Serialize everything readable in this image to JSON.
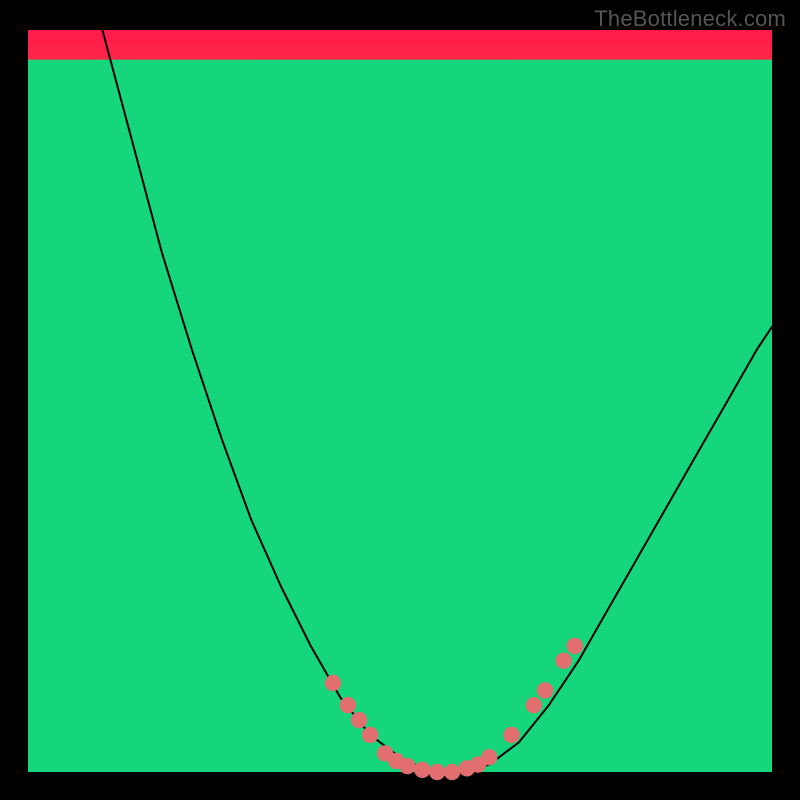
{
  "watermark": "TheBottleneck.com",
  "chart_data": {
    "type": "line",
    "title": "",
    "xlabel": "",
    "ylabel": "",
    "xlim": [
      0,
      100
    ],
    "ylim": [
      0,
      100
    ],
    "background_gradient": {
      "stops": [
        {
          "offset": 0,
          "color": "#ff1a4b"
        },
        {
          "offset": 25,
          "color": "#ff6a3a"
        },
        {
          "offset": 50,
          "color": "#ffd23a"
        },
        {
          "offset": 72,
          "color": "#fff85a"
        },
        {
          "offset": 85,
          "color": "#e8ffb8"
        },
        {
          "offset": 93,
          "color": "#8dffc0"
        },
        {
          "offset": 100,
          "color": "#1be08a"
        }
      ]
    },
    "bottom_band": {
      "from_y": 96,
      "to_y": 100,
      "color": "#15d67a"
    },
    "series": [
      {
        "name": "bottleneck-curve",
        "color": "#000000",
        "width": 2,
        "points": [
          {
            "x": 10,
            "y": 100
          },
          {
            "x": 14,
            "y": 85
          },
          {
            "x": 18,
            "y": 70
          },
          {
            "x": 22,
            "y": 57
          },
          {
            "x": 26,
            "y": 45
          },
          {
            "x": 30,
            "y": 34
          },
          {
            "x": 34,
            "y": 25
          },
          {
            "x": 38,
            "y": 17
          },
          {
            "x": 42,
            "y": 10
          },
          {
            "x": 46,
            "y": 5
          },
          {
            "x": 50,
            "y": 2
          },
          {
            "x": 54,
            "y": 0
          },
          {
            "x": 58,
            "y": 0
          },
          {
            "x": 62,
            "y": 1
          },
          {
            "x": 66,
            "y": 4
          },
          {
            "x": 70,
            "y": 9
          },
          {
            "x": 74,
            "y": 15
          },
          {
            "x": 78,
            "y": 22
          },
          {
            "x": 82,
            "y": 29
          },
          {
            "x": 86,
            "y": 36
          },
          {
            "x": 90,
            "y": 43
          },
          {
            "x": 94,
            "y": 50
          },
          {
            "x": 98,
            "y": 57
          },
          {
            "x": 100,
            "y": 60
          }
        ]
      }
    ],
    "markers": {
      "color": "#e26f6f",
      "radius_pct": 1.1,
      "points": [
        {
          "x": 41,
          "y": 12
        },
        {
          "x": 43,
          "y": 9
        },
        {
          "x": 44.5,
          "y": 7
        },
        {
          "x": 46,
          "y": 5
        },
        {
          "x": 48,
          "y": 2.5
        },
        {
          "x": 49.5,
          "y": 1.5
        },
        {
          "x": 51,
          "y": 0.8
        },
        {
          "x": 53,
          "y": 0.3
        },
        {
          "x": 55,
          "y": 0
        },
        {
          "x": 57,
          "y": 0
        },
        {
          "x": 59,
          "y": 0.5
        },
        {
          "x": 60.5,
          "y": 1
        },
        {
          "x": 62,
          "y": 2
        },
        {
          "x": 65,
          "y": 5
        },
        {
          "x": 68,
          "y": 9
        },
        {
          "x": 69.5,
          "y": 11
        },
        {
          "x": 72,
          "y": 15
        },
        {
          "x": 73.5,
          "y": 17
        }
      ]
    }
  }
}
